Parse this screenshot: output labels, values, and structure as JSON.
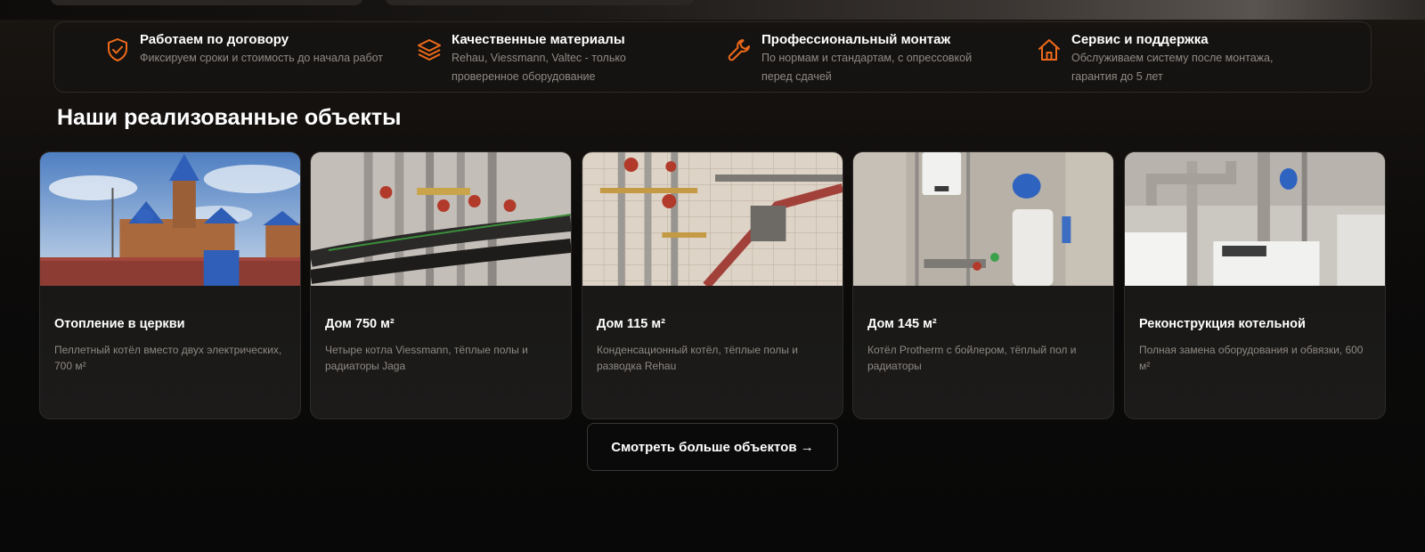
{
  "colors": {
    "accent": "#ee6a1a",
    "background": "#0a0909",
    "card": "#1a1917",
    "muted_text": "#8f8984"
  },
  "features": [
    {
      "icon": "shield-check-icon",
      "title": "Работаем по договору",
      "desc": "Фиксируем сроки и стоимость до начала работ"
    },
    {
      "icon": "layers-icon",
      "title": "Качественные материалы",
      "desc": "Rehau, Viessmann, Valtec - только проверенное оборудование"
    },
    {
      "icon": "wrench-icon",
      "title": "Профессиональный монтаж",
      "desc": "По нормам и стандартам, с опрессовкой перед сдачей"
    },
    {
      "icon": "house-icon",
      "title": "Сервис и поддержка",
      "desc": "Обслуживаем систему после монтажа, гарантия до 5 лет"
    }
  ],
  "section_title": "Наши реализованные объекты",
  "projects": [
    {
      "title": "Отопление в церкви",
      "desc": "Пеллетный котёл вместо двух электрических, 700 м²"
    },
    {
      "title": "Дом 750 м²",
      "desc": "Четыре котла Viessmann, тёплые полы и радиаторы Jaga"
    },
    {
      "title": "Дом 115 м²",
      "desc": "Конденсационный котёл, тёплые полы и разводка Rehau"
    },
    {
      "title": "Дом 145 м²",
      "desc": "Котёл Protherm с бойлером, тёплый пол и радиаторы"
    },
    {
      "title": "Реконструкция котельной",
      "desc": "Полная замена оборудования и обвязки, 600 м²"
    }
  ],
  "more_button": "Смотреть больше объектов →"
}
